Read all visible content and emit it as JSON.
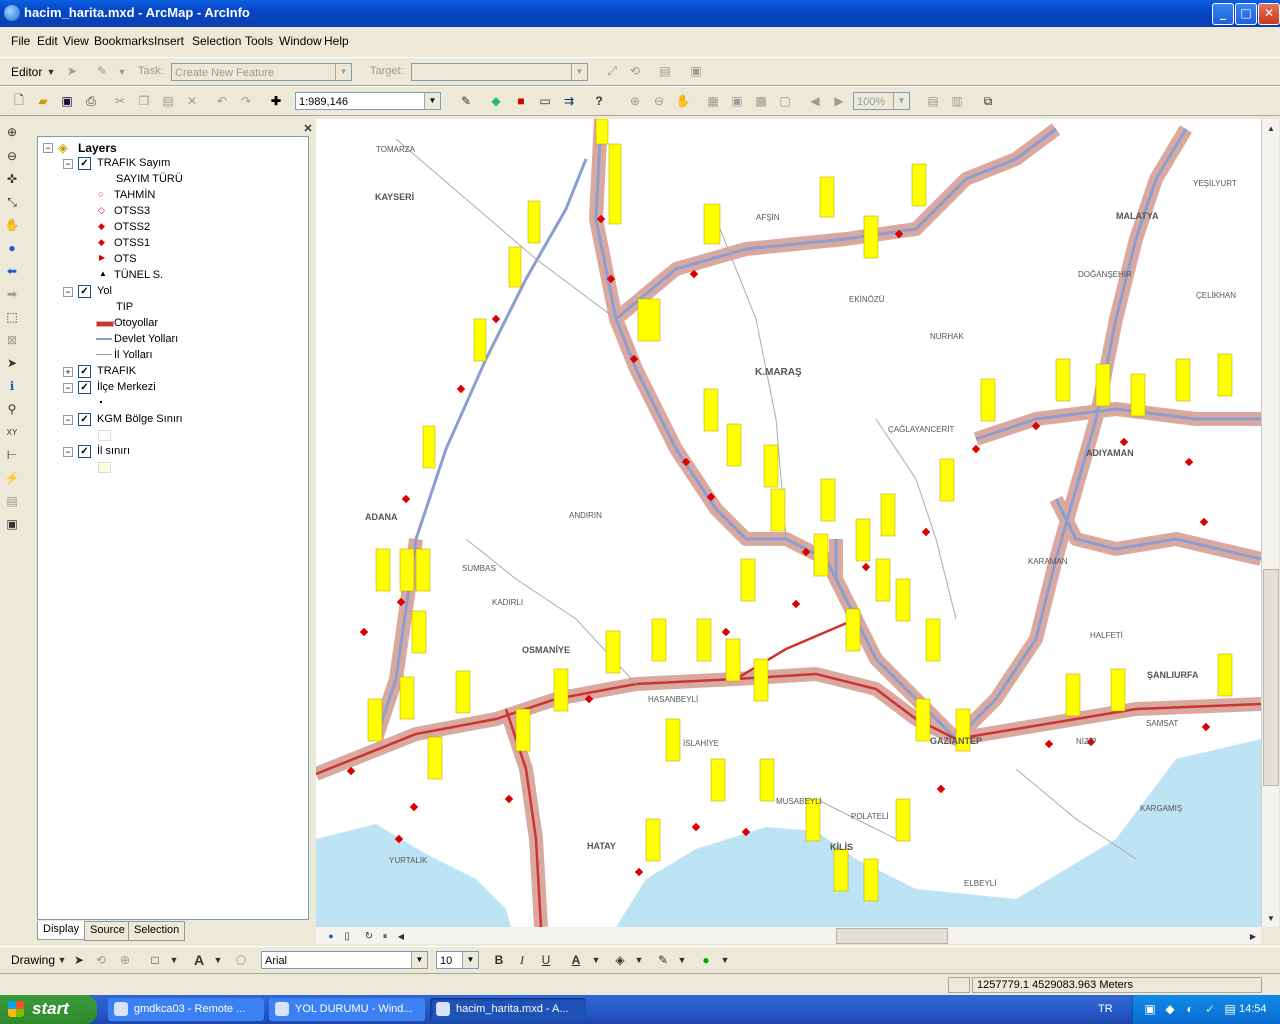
{
  "window": {
    "title": "hacim_harita.mxd - ArcMap - ArcInfo",
    "min": "_",
    "max": "□",
    "close": "✕"
  },
  "menu": [
    "File",
    "Edit",
    "View",
    "Bookmarks",
    "Insert",
    "Selection",
    "Tools",
    "Window",
    "Help"
  ],
  "editor_toolbar": {
    "editor_label": "Editor",
    "task_label": "Task:",
    "task_value": "Create New Feature",
    "target_label": "Target:"
  },
  "standard_toolbar": {
    "scale": "1:989,146",
    "zoom": "100%"
  },
  "toc": {
    "root": "Layers",
    "layers": [
      {
        "name": "TRAFIK Sayım",
        "checked": true,
        "expanded": true,
        "field": "SAYIM TÜRÜ",
        "legend": [
          "TAHMİN",
          "OTSS3",
          "OTSS2",
          "OTSS1",
          "OTS",
          "TÜNEL S."
        ]
      },
      {
        "name": "Yol",
        "checked": true,
        "expanded": true,
        "field": "TIP",
        "legend": [
          "Otoyollar",
          "Devlet Yolları",
          "İl Yolları"
        ]
      },
      {
        "name": "TRAFIK",
        "checked": true,
        "expanded": false
      },
      {
        "name": "İlçe Merkezi",
        "checked": true,
        "expanded": true
      },
      {
        "name": "KGM Bölge Sınırı",
        "checked": true,
        "expanded": true
      },
      {
        "name": "İl sınırı",
        "checked": true,
        "expanded": true
      }
    ],
    "tabs": [
      "Display",
      "Source",
      "Selection"
    ]
  },
  "map": {
    "places": [
      {
        "name": "TOMARZA"
      },
      {
        "name": "KAYSERİ"
      },
      {
        "name": "AFŞİN"
      },
      {
        "name": "MALATYA"
      },
      {
        "name": "EKİNÖZÜ"
      },
      {
        "name": "NURHAK"
      },
      {
        "name": "K.MARAŞ"
      },
      {
        "name": "ÇAĞLAYANCERİT"
      },
      {
        "name": "ADANA"
      },
      {
        "name": "ANDIRIN"
      },
      {
        "name": "SUMBAS"
      },
      {
        "name": "KADIRLI"
      },
      {
        "name": "OSMANİYE"
      },
      {
        "name": "HASANBEYLİ"
      },
      {
        "name": "HATAY"
      },
      {
        "name": "KİLİS"
      },
      {
        "name": "POLATELİ"
      },
      {
        "name": "MUSABEYLİ"
      },
      {
        "name": "GAZİANTEP"
      },
      {
        "name": "ŞANLIURFA"
      },
      {
        "name": "HALFETİ"
      },
      {
        "name": "ADIYAMAN"
      },
      {
        "name": "ÇELİKHAN"
      },
      {
        "name": "DOĞANŞEHİR"
      },
      {
        "name": "YURTALIK"
      },
      {
        "name": "KARGAMIŞ"
      },
      {
        "name": "ELBEYLİ"
      },
      {
        "name": "KARAMAN"
      },
      {
        "name": "İSLAHİYE"
      },
      {
        "name": "YEŞİLYURT"
      },
      {
        "name": "NİZİP"
      },
      {
        "name": "SAMSAT"
      }
    ]
  },
  "drawing_toolbar": {
    "drawing_label": "Drawing",
    "font": "Arial",
    "font_size": "10",
    "bold": "B",
    "italic": "I",
    "underline": "U",
    "font_color_glyph": "A"
  },
  "status": {
    "coords": "1257779.1  4529083.963 Meters"
  },
  "taskbar": {
    "start": "start",
    "tasks": [
      {
        "label": "gmdkca03 - Remote ..."
      },
      {
        "label": "YOL DURUMU - Wind..."
      },
      {
        "label": "hacim_harita.mxd - A..."
      }
    ],
    "lang": "TR",
    "clock": "14:54"
  },
  "colors": {
    "highway": "#cc3333",
    "buffer": "#d9a9a0",
    "state_road": "#8b9ed1",
    "label_bg": "#ffff00",
    "sea": "#bde4f5"
  }
}
